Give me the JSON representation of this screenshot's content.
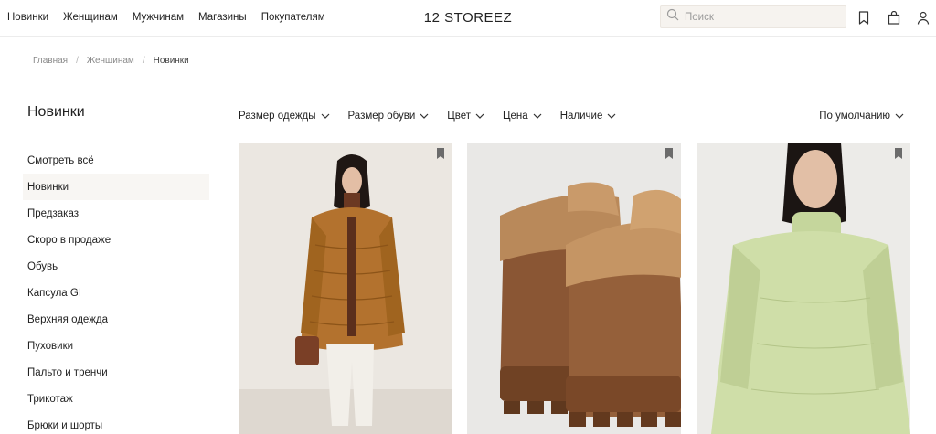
{
  "header": {
    "nav": [
      "Новинки",
      "Женщинам",
      "Мужчинам",
      "Магазины",
      "Покупателям"
    ],
    "logo": "12 STOREEZ",
    "search_placeholder": "Поиск",
    "icons": [
      "bookmark-icon",
      "bag-icon",
      "user-icon"
    ]
  },
  "breadcrumb": [
    "Главная",
    "Женщинам",
    "Новинки"
  ],
  "page_title": "Новинки",
  "sidebar": {
    "items": [
      "Смотреть всё",
      "Новинки",
      "Предзаказ",
      "Скоро в продаже",
      "Обувь",
      "Капсула GI",
      "Верхняя одежда",
      "Пуховики",
      "Пальто и тренчи",
      "Трикотаж",
      "Брюки и шорты"
    ],
    "active": "Новинки"
  },
  "filters": [
    "Размер одежды",
    "Размер обуви",
    "Цвет",
    "Цена",
    "Наличие"
  ],
  "sort": "По умолчанию",
  "products": [
    {
      "image": "model-in-brown-puffer-jacket",
      "bg": "#e9e5df"
    },
    {
      "image": "brown-suede-boots-with-shearling-cuff",
      "bg": "#e9e8e6"
    },
    {
      "image": "model-in-green-turtleneck-sweater",
      "bg": "#ecebe8"
    }
  ],
  "colors": {
    "text": "#222222",
    "muted": "#8a8a8a",
    "search_bg": "#f6f3ef",
    "active_bg": "#f8f6f3"
  }
}
